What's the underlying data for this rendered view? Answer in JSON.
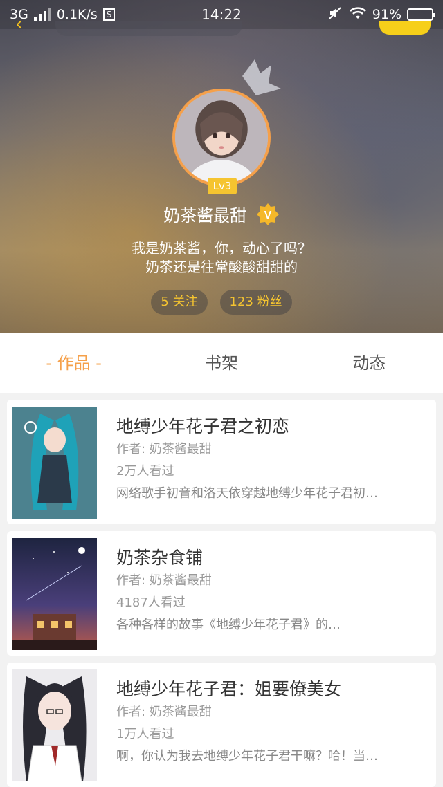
{
  "status_bar": {
    "network": "3G",
    "speed": "0.1K/s",
    "sim_icon_label": "S",
    "time": "14:22",
    "battery": "91%",
    "battery_level": 0.91
  },
  "profile": {
    "level": "Lv3",
    "name": "奶茶酱最甜",
    "verified_badge": "V",
    "bio_line1": "我是奶茶酱，你，动心了吗？",
    "bio_line2": "奶茶还是往常酸酸甜甜的",
    "following": "5 关注",
    "followers": "123 粉丝"
  },
  "tabs": [
    {
      "label": "- 作品 -",
      "active": true
    },
    {
      "label": "书架",
      "active": false
    },
    {
      "label": "动态",
      "active": false
    }
  ],
  "works": [
    {
      "title": "地缚少年花子君之初恋",
      "author": "作者: 奶茶酱最甜",
      "views": "2万人看过",
      "desc": "网络歌手初音和洛天依穿越地缚少年花子君初…"
    },
    {
      "title": "奶茶杂食铺",
      "author": "作者: 奶茶酱最甜",
      "views": "4187人看过",
      "desc": "各种各样的故事《地缚少年花子君》的…"
    },
    {
      "title": "地缚少年花子君：姐要僚美女",
      "author": "作者: 奶茶酱最甜",
      "views": "1万人看过",
      "desc": "啊，你认为我去地缚少年花子君干嘛？哈！当…"
    }
  ],
  "colors": {
    "accent": "#f5a04a",
    "level_badge": "#f5c430",
    "pill_text": "#f5c430"
  }
}
